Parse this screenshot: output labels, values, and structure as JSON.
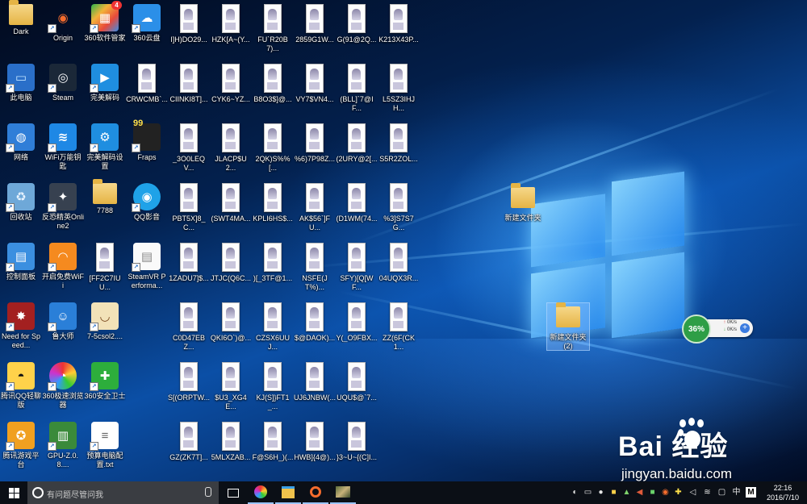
{
  "desktop": {
    "icons": [
      {
        "label": "Dark",
        "kind": "folder"
      },
      {
        "label": "Origin",
        "kind": "origin-icon"
      },
      {
        "label": "360软件管家",
        "kind": "360-software-icon",
        "badge": "4"
      },
      {
        "label": "360云盘",
        "kind": "cloud-icon"
      },
      {
        "label": "I]H)DO29...",
        "kind": "image-file"
      },
      {
        "label": "HZK[A~(Y...",
        "kind": "image-file"
      },
      {
        "label": "FU`R20B7)...",
        "kind": "image-file"
      },
      {
        "label": "2859G1W...",
        "kind": "image-file"
      },
      {
        "label": "G(91@2Q...",
        "kind": "image-file"
      },
      {
        "label": "K213X43P...",
        "kind": "image-file"
      },
      {
        "label": "此电脑",
        "kind": "computer-icon"
      },
      {
        "label": "Steam",
        "kind": "steam-icon"
      },
      {
        "label": "完美解码",
        "kind": "media-player-icon"
      },
      {
        "label": "CRWCMB`...",
        "kind": "image-file"
      },
      {
        "label": "CIINKI8T]...",
        "kind": "image-file"
      },
      {
        "label": "CYK6~YZ...",
        "kind": "image-file"
      },
      {
        "label": "B8O3$]@...",
        "kind": "image-file"
      },
      {
        "label": "VY7$VN4...",
        "kind": "image-file"
      },
      {
        "label": "(BLL]`7@IF...",
        "kind": "image-file"
      },
      {
        "label": "L5SZ3IHJH...",
        "kind": "image-file"
      },
      {
        "label": "网络",
        "kind": "network-icon"
      },
      {
        "label": "WiFi万能钥匙",
        "kind": "wifi-key-icon"
      },
      {
        "label": "完美解码设置",
        "kind": "settings-icon"
      },
      {
        "label": "Fraps",
        "kind": "fraps-icon",
        "badge": "99"
      },
      {
        "label": "_3O0LEQV...",
        "kind": "image-file"
      },
      {
        "label": "JLACP$U2...",
        "kind": "image-file"
      },
      {
        "label": "2QK)S%%[...",
        "kind": "image-file"
      },
      {
        "label": "%6)7P98Z...",
        "kind": "image-file"
      },
      {
        "label": "(2URY@2[...",
        "kind": "image-file"
      },
      {
        "label": "S5R2ZOL...",
        "kind": "image-file"
      },
      {
        "label": "回收站",
        "kind": "recycle-bin-icon"
      },
      {
        "label": "反恐精英Online2",
        "kind": "csol2-icon"
      },
      {
        "label": "7788",
        "kind": "folder"
      },
      {
        "label": "QQ影音",
        "kind": "qq-player-icon"
      },
      {
        "label": "PBT5X]8_C...",
        "kind": "image-file"
      },
      {
        "label": "(SWT4MA...",
        "kind": "image-file"
      },
      {
        "label": "KPLI6HS$...",
        "kind": "image-file"
      },
      {
        "label": "AK$56`]FU...",
        "kind": "image-file"
      },
      {
        "label": "(D1WM(74...",
        "kind": "image-file"
      },
      {
        "label": "%3]S7S7G...",
        "kind": "image-file"
      },
      {
        "label": "控制面板",
        "kind": "control-panel-icon"
      },
      {
        "label": "开启免费WiFi",
        "kind": "free-wifi-icon"
      },
      {
        "label": "[FF2C7IUU...",
        "kind": "image-file"
      },
      {
        "label": "SteamVR Performa...",
        "kind": "document-icon"
      },
      {
        "label": "1ZADU7]$...",
        "kind": "image-file"
      },
      {
        "label": "JTJC(Q6C...",
        "kind": "image-file"
      },
      {
        "label": ")[_3TF@1...",
        "kind": "image-file"
      },
      {
        "label": "NSFE(JT%)...",
        "kind": "image-file"
      },
      {
        "label": "SFY)[Q[WF...",
        "kind": "image-file"
      },
      {
        "label": "04UQX3R...",
        "kind": "image-file"
      },
      {
        "label": "Need for Speed...",
        "kind": "nfs-icon"
      },
      {
        "label": "鲁大师",
        "kind": "ludashi-icon"
      },
      {
        "label": "7-5csol2....",
        "kind": "bowl-icon"
      },
      {
        "label": "C0D47EBZ...",
        "kind": "image-file"
      },
      {
        "label": "QKI6O`)@...",
        "kind": "image-file"
      },
      {
        "label": "CZSX6UUJ...",
        "kind": "image-file"
      },
      {
        "label": "$@DAOK)...",
        "kind": "image-file"
      },
      {
        "label": "Y(_O9FBX...",
        "kind": "image-file"
      },
      {
        "label": "ZZ(6F(CK1...",
        "kind": "image-file"
      },
      {
        "label": "腾讯QQ轻聊版",
        "kind": "qq-icon"
      },
      {
        "label": "360极速浏览器",
        "kind": "360-browser-icon"
      },
      {
        "label": "360安全卫士",
        "kind": "360-security-icon"
      },
      {
        "label": "S[(ORPTW...",
        "kind": "image-file"
      },
      {
        "label": "$U3_XG4E...",
        "kind": "image-file"
      },
      {
        "label": "KJ(S]}FT1_...",
        "kind": "image-file"
      },
      {
        "label": "UJ6JNBW(...",
        "kind": "image-file"
      },
      {
        "label": "UQU$@`7...",
        "kind": "image-file"
      },
      {
        "label": "腾讯游戏平台",
        "kind": "tencent-game-icon"
      },
      {
        "label": "GPU-Z.0.8....",
        "kind": "gpuz-icon"
      },
      {
        "label": "预算电脑配置.txt",
        "kind": "text-file-icon"
      },
      {
        "label": "GZ(ZK7T]...",
        "kind": "image-file"
      },
      {
        "label": "5MLXZAB...",
        "kind": "image-file"
      },
      {
        "label": "F@S6H_)(...",
        "kind": "image-file"
      },
      {
        "label": "HWB]{4@)...",
        "kind": "image-file"
      },
      {
        "label": "}3~U~{(C]I...",
        "kind": "image-file"
      }
    ],
    "right_folders": [
      {
        "label": "新建文件夹"
      },
      {
        "label": "新建文件夹 (2)"
      }
    ],
    "speed_widget": {
      "percent": "36%",
      "up": "0K/s",
      "down": "0K/s"
    },
    "watermark": {
      "brand": "Bai  经验",
      "url": "jingyan.baidu.com"
    }
  },
  "taskbar": {
    "search_placeholder": "有问题尽管问我",
    "pinned": [
      "task-view",
      "360-browser",
      "file-explorer",
      "origin",
      "game"
    ],
    "tray": [
      "steam-tray-icon",
      "taskbar-icon",
      "360-tray-icon",
      "volume-icon",
      "network-icon",
      "message-icon"
    ],
    "ime": "中",
    "ime2": "M",
    "time": "22:16",
    "date": "2016/7/10"
  },
  "colors": {
    "accent": "#0b4fa6",
    "taskbar": "#0b0f16",
    "search_box": "#3a3d42"
  }
}
